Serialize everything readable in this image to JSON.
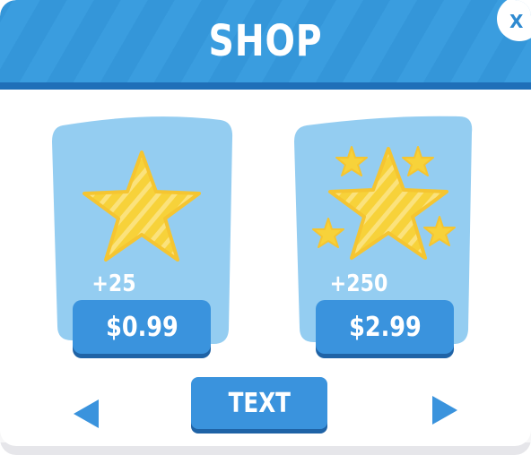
{
  "shop": {
    "title": "SHOP",
    "close_label": "X",
    "items": [
      {
        "amount": "+25",
        "price": "$0.99",
        "icon": "single-star-icon"
      },
      {
        "amount": "+250",
        "price": "$2.99",
        "icon": "star-cluster-icon"
      }
    ],
    "action_button_label": "TEXT",
    "nav": {
      "prev_icon": "arrow-left-icon",
      "next_icon": "arrow-right-icon"
    }
  },
  "colors": {
    "header_blue": "#3a9ddf",
    "button_blue": "#3a93dd",
    "card_blue": "#94cdf1",
    "star_yellow": "#f7d23a",
    "white": "#ffffff"
  }
}
